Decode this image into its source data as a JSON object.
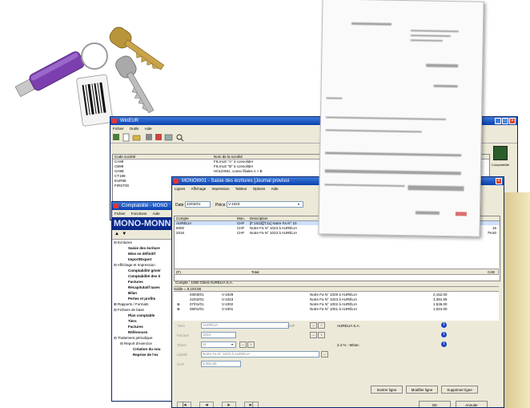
{
  "winEUR": {
    "title": "WinEUR",
    "menu": [
      "Fichier",
      "Outils",
      "Aide"
    ],
    "columns": [
      "Code société",
      "Nom de la société"
    ],
    "rows": [
      {
        "code": "CA99",
        "name": "FILIALE \"A\" à consolider"
      },
      {
        "code": "CB99",
        "name": "FILIALE \"B\" à consolider"
      },
      {
        "code": "CH99",
        "name": "HOLDING, conso filiales A + B"
      },
      {
        "code": "CT199",
        "name": ""
      },
      {
        "code": "EUR99",
        "name": ""
      },
      {
        "code": "FIRST00",
        "name": ""
      }
    ],
    "right_icon_label": "Comptabilité"
  },
  "compta": {
    "title": "Comptabilité - MONO",
    "menu": [
      "Fichier",
      "Fonctions",
      "Aide"
    ],
    "header": "MONO-MONNA",
    "tree": [
      {
        "label": "Ecritures",
        "level": 0,
        "bold": false
      },
      {
        "label": "Saisie des écriture",
        "level": 1,
        "bold": true
      },
      {
        "label": "Mise en définitif",
        "level": 1,
        "bold": true
      },
      {
        "label": "Import/Export",
        "level": 1,
        "bold": true
      },
      {
        "label": "Affichage et Impression",
        "level": 0,
        "bold": false
      },
      {
        "label": "Comptabilité génér",
        "level": 1,
        "bold": true
      },
      {
        "label": "Comptabilité des ti",
        "level": 1,
        "bold": true
      },
      {
        "label": "Factures",
        "level": 1,
        "bold": true
      },
      {
        "label": "Récapitulatif taxes",
        "level": 1,
        "bold": true
      },
      {
        "label": "Bilan",
        "level": 1,
        "bold": true
      },
      {
        "label": "Pertes et profits",
        "level": 1,
        "bold": true
      },
      {
        "label": "Rapports / Formats",
        "level": 0,
        "bold": false
      },
      {
        "label": "Fichiers de base",
        "level": 0,
        "bold": false
      },
      {
        "label": "Plan comptable",
        "level": 1,
        "bold": true
      },
      {
        "label": "Tiers",
        "level": 1,
        "bold": true
      },
      {
        "label": "Factures",
        "level": 1,
        "bold": true
      },
      {
        "label": "Références",
        "level": 1,
        "bold": true
      },
      {
        "label": "Traitement périodique",
        "level": 0,
        "bold": false
      },
      {
        "label": "Report d'exercice",
        "level": 1,
        "bold": false
      },
      {
        "label": "Création du nou",
        "level": 2,
        "bold": true
      },
      {
        "label": "Reprise de l'ex",
        "level": 2,
        "bold": true
      }
    ]
  },
  "saisie": {
    "title": "MONOW01 - Saisie des écritures [Journal provisoi",
    "menu": [
      "Lignes",
      "Affichage",
      "Impression",
      "Tableur",
      "Options",
      "Aide"
    ],
    "date_label": "Date",
    "date_value": "22/02/01",
    "piece_label": "Pièce",
    "piece_value": "V-1023",
    "columns": [
      "Compte",
      "Mon.",
      "Description"
    ],
    "lines": [
      {
        "compte": "AURÉLIA",
        "mon": "CHF",
        "desc": "[F:1023][T:11] Notre Fa N° 10",
        "amount": ""
      },
      {
        "compte": "6000",
        "mon": "CHF",
        "desc": "Notre Fa N° 1023 à AURÉLIA",
        "amount": "15"
      },
      {
        "compte": "2016",
        "mon": "CHF",
        "desc": "Notre Fa N° 1023 à AURÉLIA",
        "amount": "79.50"
      }
    ],
    "total_code": "(F)",
    "total_label": "Total",
    "total_value": "0.00",
    "account_line": "Compte : 1050 Client AURELIA S.A.",
    "solde_line": "Solde = 8,103.55",
    "history": [
      {
        "date": "03/03/01",
        "piece": "V-1029",
        "desc": "Notre Fa N° 1029 à AURÉLIA",
        "amount": "2,152.00"
      },
      {
        "date": "22/02/01",
        "piece": "V-1023",
        "desc": "Notre Fa N° 1023 à AURÉLIA",
        "amount": "3,391.55"
      },
      {
        "date": "07/01/01",
        "piece": "V-1002",
        "desc": "Notre Fa N° 1002 à AURÉLIA",
        "amount": "1,536.00"
      },
      {
        "date": "06/01/01",
        "piece": "V-1001",
        "desc": "Notre Fa N° 1001 à AURÉLIA",
        "amount": "1,024.00"
      }
    ],
    "form": {
      "tiers_label": "Tiers",
      "tiers_value": "AURÉLIA",
      "tiers_currency": "CHF",
      "tiers_name": "AURELIA S.A.",
      "facture_label": "Facture",
      "facture_value": "1023",
      "taxes_label": "Taxes",
      "taxes_value": "11",
      "taxes_desc": "2.4 % - M/sec",
      "libelle_label": "Libellé",
      "libelle_value": "Notre Fa N° 1023 à AURÉLIA",
      "chf_label": "CHF",
      "chf_value": "3,391.55"
    },
    "buttons": {
      "insert": "Insérer ligne",
      "modify": "Modifier ligne",
      "delete": "Supprimer ligne",
      "ok": "OK",
      "cancel": "Annuler"
    }
  },
  "colors": {
    "titlebar": "#0a3fb0",
    "selection": "#cde0fb",
    "compta_header": "#0a2a8a"
  },
  "icons": [
    "usb-key-icon",
    "keys-icon",
    "printed-document-icon",
    "comptabilite-app-icon"
  ]
}
